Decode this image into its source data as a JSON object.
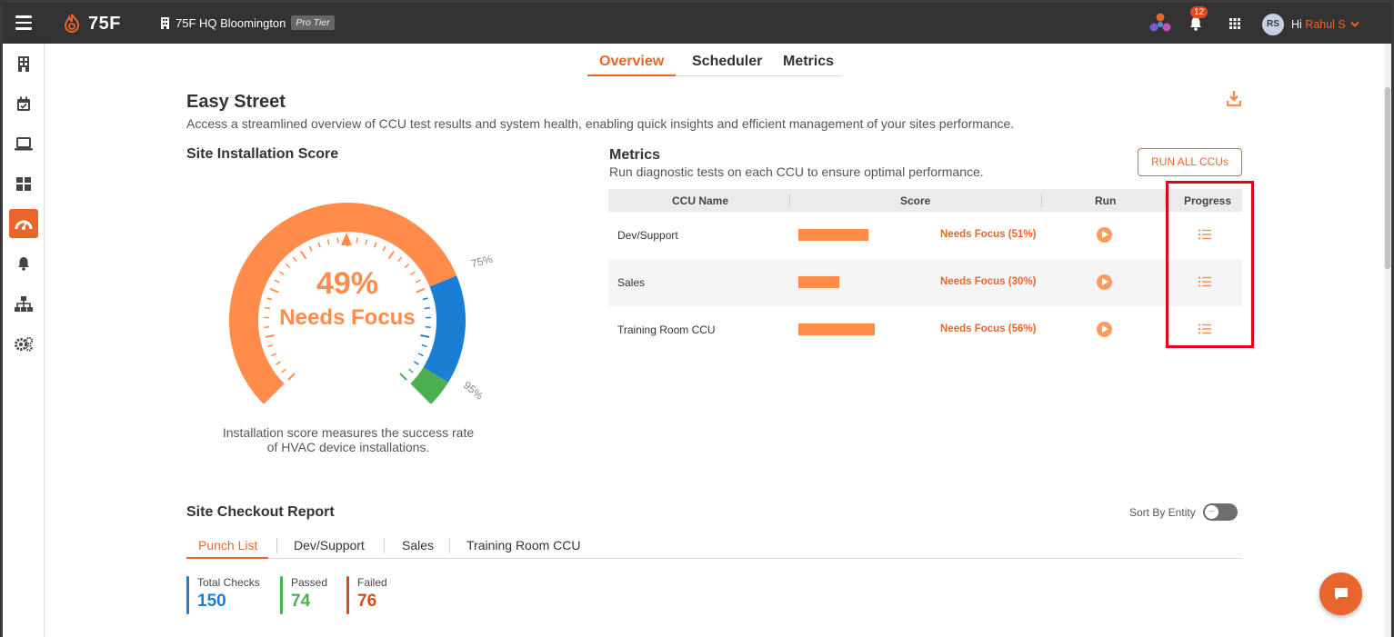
{
  "header": {
    "logo_text": "75F",
    "site_name": "75F HQ Bloomington",
    "tier": "Pro Tier",
    "notification_count": "12",
    "avatar_initials": "RS",
    "greeting": "Hi",
    "user_name": "Rahul S"
  },
  "sidebar": {
    "items": [
      {
        "icon": "building-icon"
      },
      {
        "icon": "calendar-check-icon"
      },
      {
        "icon": "laptop-icon"
      },
      {
        "icon": "dashboard-grid-icon"
      },
      {
        "icon": "gauge-icon",
        "active": true
      },
      {
        "icon": "bell-icon"
      },
      {
        "icon": "hierarchy-icon"
      },
      {
        "icon": "gears-icon"
      }
    ]
  },
  "tabs": [
    "Overview",
    "Scheduler",
    "Metrics"
  ],
  "page": {
    "title": "Easy Street",
    "description": "Access a streamlined overview of CCU test results and system health, enabling quick insights and efficient management of your sites performance."
  },
  "installation": {
    "title": "Site Installation Score",
    "score": "49%",
    "status": "Needs Focus",
    "score_value": 0.49,
    "marker_75": "75%",
    "marker_95": "95%",
    "caption_line1": "Installation score measures the success rate",
    "caption_line2": "of HVAC device installations."
  },
  "metrics": {
    "title": "Metrics",
    "description": "Run diagnostic tests on each CCU to ensure optimal performance.",
    "run_all_label": "RUN ALL CCUs",
    "columns": [
      "CCU Name",
      "Score",
      "Run",
      "Progress"
    ],
    "rows": [
      {
        "name": "Dev/Support",
        "score": 51,
        "status": "Needs Focus (51%)"
      },
      {
        "name": "Sales",
        "score": 30,
        "status": "Needs Focus (30%)"
      },
      {
        "name": "Training Room CCU",
        "score": 56,
        "status": "Needs Focus (56%)"
      }
    ]
  },
  "checkout": {
    "title": "Site Checkout Report",
    "sort_label": "Sort By Entity",
    "tabs": [
      "Punch List",
      "Dev/Support",
      "Sales",
      "Training Room CCU"
    ],
    "stats": [
      {
        "label": "Total Checks",
        "value": "150",
        "color": "#1a7fd4"
      },
      {
        "label": "Passed",
        "value": "74",
        "color": "#4caf50"
      },
      {
        "label": "Failed",
        "value": "76",
        "color": "#d84a1b"
      }
    ]
  },
  "colors": {
    "accent": "#e8662b",
    "gauge_orange": "#ff8c4b",
    "gauge_blue": "#1a7fd4",
    "gauge_green": "#4caf50"
  }
}
